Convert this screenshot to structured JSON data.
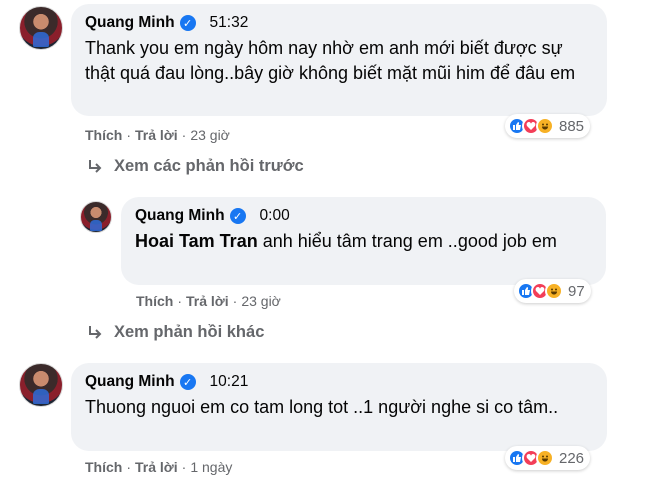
{
  "comments": [
    {
      "name": "Quang Minh",
      "time": "51:32",
      "text": "Thank you em ngày hôm nay nhờ em anh mới biết được sự thật quá đau lòng..bây giờ không biết mặt mũi him để đâu em",
      "like_label": "Thích",
      "reply_label": "Trả lời",
      "age": "23 giờ",
      "reaction_count": "885"
    },
    {
      "name": "Quang Minh",
      "time": "0:00",
      "mention": "Hoai Tam Tran",
      "text": " anh hiểu tâm trang em ..good job em",
      "like_label": "Thích",
      "reply_label": "Trả lời",
      "age": "23 giờ",
      "reaction_count": "97"
    },
    {
      "name": "Quang Minh",
      "time": "10:21",
      "text": "Thuong nguoi em co tam long tot ..1 người nghe si co tâm..",
      "like_label": "Thích",
      "reply_label": "Trả lời",
      "age": "1 ngày",
      "reaction_count": "226"
    }
  ],
  "view_previous_replies": "Xem các phản hồi trước",
  "view_more_replies": "Xem phản hồi khác",
  "verified_badge": "✓",
  "separator": "·",
  "colors": {
    "bubble": "#f0f2f5",
    "meta": "#65676b",
    "verified": "#1877f2",
    "like": "#1877f2",
    "love": "#f33e58",
    "haha": "#f7b125"
  },
  "icons": [
    "verified-badge-icon",
    "like-reaction-icon",
    "love-reaction-icon",
    "haha-reaction-icon",
    "reply-arrow-icon"
  ]
}
